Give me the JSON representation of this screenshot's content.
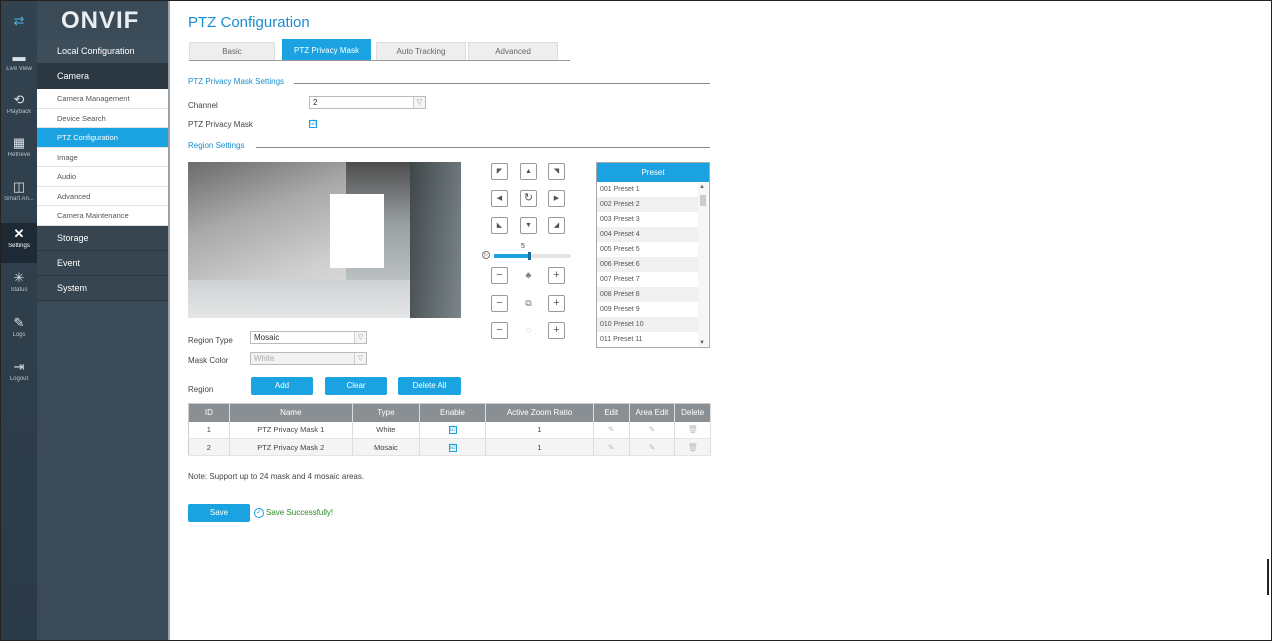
{
  "rail": {
    "items": [
      {
        "name": "menu-toggle-icon",
        "glyph": "⇄",
        "label": ""
      },
      {
        "name": "live-view-icon",
        "glyph": "▬",
        "label": "Live View"
      },
      {
        "name": "playback-icon",
        "glyph": "⟲",
        "label": "Playback"
      },
      {
        "name": "retrieve-icon",
        "glyph": "▦",
        "label": "Retrieve"
      },
      {
        "name": "smart-analysis-icon",
        "glyph": "◫",
        "label": "Smart An..."
      },
      {
        "name": "settings-icon",
        "glyph": "✕",
        "label": "Settings"
      },
      {
        "name": "status-icon",
        "glyph": "✳",
        "label": "Status"
      },
      {
        "name": "logs-icon",
        "glyph": "✎",
        "label": "Logs"
      },
      {
        "name": "logout-icon",
        "glyph": "⇥",
        "label": "Logout"
      }
    ]
  },
  "brand": {
    "logo": "ONVIF"
  },
  "menu": {
    "local_configuration": "Local Configuration",
    "camera": "Camera",
    "camera_items": [
      "Camera Management",
      "Device Search",
      "PTZ Configuration",
      "Image",
      "Audio",
      "Advanced",
      "Camera Maintenance"
    ],
    "storage": "Storage",
    "event": "Event",
    "system": "System"
  },
  "page": {
    "title": "PTZ Configuration",
    "tabs": [
      "Basic",
      "PTZ Privacy Mask",
      "Auto Tracking",
      "Advanced"
    ],
    "active_tab": "PTZ Privacy Mask"
  },
  "settings": {
    "section_title": "PTZ Privacy Mask Settings",
    "channel_label": "Channel",
    "channel_value": "2",
    "mask_label": "PTZ Privacy Mask",
    "mask_enabled": "☑"
  },
  "region": {
    "section_title": "Region Settings",
    "region_type_label": "Region Type",
    "region_type_value": "Mosaic",
    "mask_color_label": "Mask Color",
    "mask_color_value": "White",
    "region_label": "Region",
    "add": "Add",
    "clear": "Clear",
    "delete_all": "Delete All"
  },
  "ptz": {
    "speed_value": "5",
    "speed_fraction": 0.45
  },
  "preset": {
    "title": "Preset",
    "items": [
      "001  Preset 1",
      "002  Preset 2",
      "003  Preset 3",
      "004  Preset 4",
      "005  Preset 5",
      "006  Preset 6",
      "007  Preset 7",
      "008  Preset 8",
      "009  Preset 9",
      "010  Preset 10",
      "011  Preset 11"
    ]
  },
  "table": {
    "headers": [
      "ID",
      "Name",
      "Type",
      "Enable",
      "Active Zoom Ratio",
      "Edit",
      "Area Edit",
      "Delete"
    ],
    "rows": [
      {
        "id": "1",
        "name": "PTZ Privacy Mask 1",
        "type": "White",
        "enable": "☑",
        "zoom": "1"
      },
      {
        "id": "2",
        "name": "PTZ Privacy Mask 2",
        "type": "Mosaic",
        "enable": "☑",
        "zoom": "1"
      }
    ]
  },
  "note": "Note: Support up to 24 mask and 4 mosaic areas.",
  "footer": {
    "save": "Save",
    "status": "Save Successfully!"
  },
  "colors": {
    "accent": "#1aa3e0",
    "rail": "#2b3a47",
    "menu": "#3a4a57"
  }
}
